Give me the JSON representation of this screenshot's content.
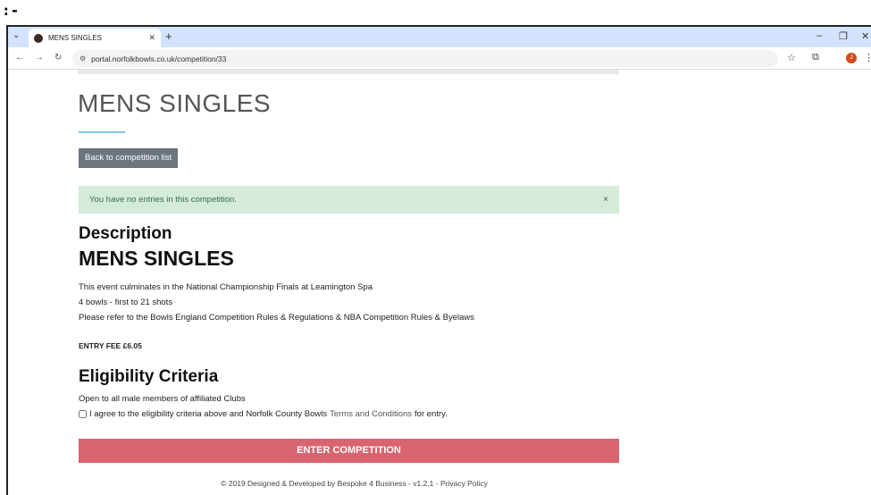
{
  "top_strip": ":-",
  "browser": {
    "tab_title": "MENS SINGLES",
    "url": "portal.norfolkbowls.co.uk/competition/33",
    "avatar_letter": "J"
  },
  "page": {
    "title": "MENS SINGLES",
    "back_button": "Back to competition list",
    "alert_text": "You have no entries in this competition.",
    "alert_close": "×",
    "description_heading": "Description",
    "description_title": "MENS SINGLES",
    "description_lines": [
      "This event culminates in the National Championship Finals at   Leamington Spa",
      "4 bowls - first to 21 shots",
      "Please refer to the Bowls England Competition Rules & Regulations & NBA Competition Rules & Byelaws"
    ],
    "entry_fee": "ENTRY FEE £6.05",
    "eligibility_heading": "Eligibility Criteria",
    "eligibility_text": "Open to all male members of affiliated Clubs",
    "agree_prefix": "I agree to the eligibility criteria above and Norfolk County Bowls",
    "agree_link": "Terms and Conditions",
    "agree_suffix": "for entry.",
    "enter_button": "ENTER COMPETITION",
    "footer_text": "© 2019 Designed & Developed by Bespoke 4 Business - v1.2.1 - ",
    "footer_link": "Privacy Policy"
  },
  "colors": {
    "alert_bg": "#d4ebd9",
    "enter_button_bg": "#d8646f",
    "back_button_bg": "#6d757d",
    "accent_underline": "#7ec3e6"
  }
}
